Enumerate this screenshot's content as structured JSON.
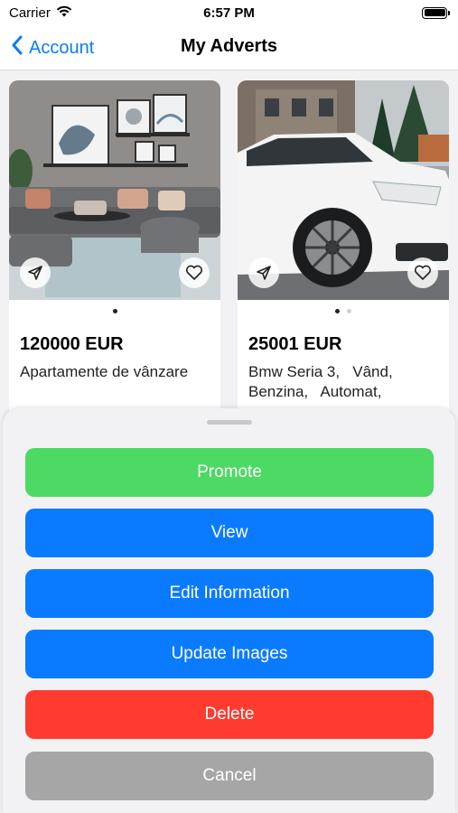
{
  "status_bar": {
    "carrier": "Carrier",
    "time": "6:57 PM",
    "battery_level": 1.0
  },
  "nav": {
    "back_label": "Account",
    "title": "My Adverts"
  },
  "adverts": [
    {
      "price": "120000 EUR",
      "description": "Apartamente de vânzare",
      "image_count": 1,
      "active_image": 0
    },
    {
      "price": "25001 EUR",
      "description": "Bmw Seria 3,   Vând,\nBenzina,   Automat,",
      "image_count": 2,
      "active_image": 0
    }
  ],
  "sheet": {
    "actions": [
      {
        "label": "Promote",
        "color": "#4cd964"
      },
      {
        "label": "View",
        "color": "#0a7bff"
      },
      {
        "label": "Edit Information",
        "color": "#0a7bff"
      },
      {
        "label": "Update Images",
        "color": "#0a7bff"
      },
      {
        "label": "Delete",
        "color": "#ff3b30"
      },
      {
        "label": "Cancel",
        "color": "#a6a6a6"
      }
    ]
  },
  "icons": {
    "back": "chevron-left-icon",
    "share": "paper-plane-icon",
    "favorite": "heart-icon",
    "wifi": "wifi-icon",
    "battery": "battery-icon"
  }
}
